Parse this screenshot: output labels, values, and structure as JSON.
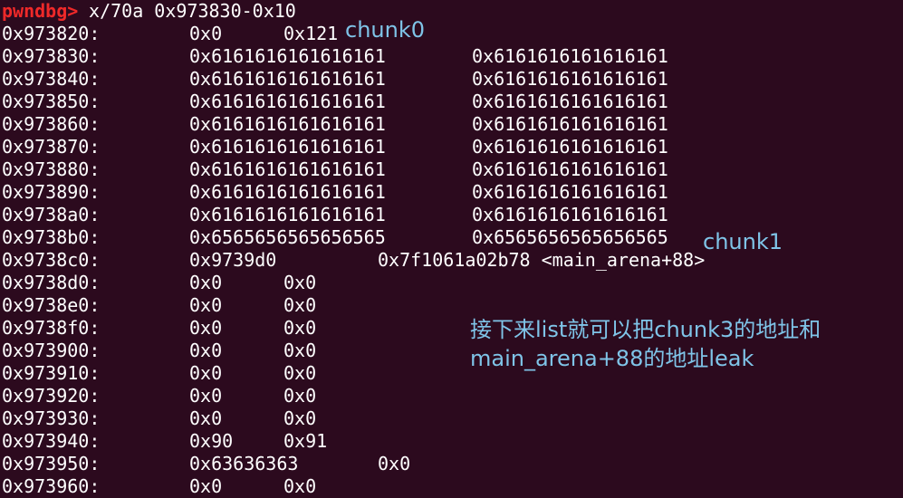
{
  "terminal": {
    "background": "#2c0a1e",
    "prompt_color": "#ef2929",
    "annotation_color": "#7fc4e8",
    "prompt": "pwndbg>",
    "command": " x/70a 0x973830-0x10",
    "rows": [
      {
        "addr": "0x973820:",
        "v1": "0x0",
        "v2": "0x121"
      },
      {
        "addr": "0x973830:",
        "v1": "0x6161616161616161",
        "v2": "0x6161616161616161"
      },
      {
        "addr": "0x973840:",
        "v1": "0x6161616161616161",
        "v2": "0x6161616161616161"
      },
      {
        "addr": "0x973850:",
        "v1": "0x6161616161616161",
        "v2": "0x6161616161616161"
      },
      {
        "addr": "0x973860:",
        "v1": "0x6161616161616161",
        "v2": "0x6161616161616161"
      },
      {
        "addr": "0x973870:",
        "v1": "0x6161616161616161",
        "v2": "0x6161616161616161"
      },
      {
        "addr": "0x973880:",
        "v1": "0x6161616161616161",
        "v2": "0x6161616161616161"
      },
      {
        "addr": "0x973890:",
        "v1": "0x6161616161616161",
        "v2": "0x6161616161616161"
      },
      {
        "addr": "0x9738a0:",
        "v1": "0x6161616161616161",
        "v2": "0x6161616161616161"
      },
      {
        "addr": "0x9738b0:",
        "v1": "0x6565656565656565",
        "v2": "0x6565656565656565"
      },
      {
        "addr": "0x9738c0:",
        "v1": "0x9739d0",
        "v2": "0x7f1061a02b78 <main_arena+88>"
      },
      {
        "addr": "0x9738d0:",
        "v1": "0x0",
        "v2": "0x0"
      },
      {
        "addr": "0x9738e0:",
        "v1": "0x0",
        "v2": "0x0"
      },
      {
        "addr": "0x9738f0:",
        "v1": "0x0",
        "v2": "0x0"
      },
      {
        "addr": "0x973900:",
        "v1": "0x0",
        "v2": "0x0"
      },
      {
        "addr": "0x973910:",
        "v1": "0x0",
        "v2": "0x0"
      },
      {
        "addr": "0x973920:",
        "v1": "0x0",
        "v2": "0x0"
      },
      {
        "addr": "0x973930:",
        "v1": "0x0",
        "v2": "0x0"
      },
      {
        "addr": "0x973940:",
        "v1": "0x90",
        "v2": "0x91"
      },
      {
        "addr": "0x973950:",
        "v1": "0x63636363",
        "v2": "0x0"
      },
      {
        "addr": "0x973960:",
        "v1": "0x0",
        "v2": "0x0"
      }
    ]
  },
  "annotations": {
    "chunk0": "chunk0",
    "chunk1": "chunk1",
    "note_line1": "接下来list就可以把chunk3的地址和",
    "note_line2": "main_arena+88的地址leak"
  }
}
